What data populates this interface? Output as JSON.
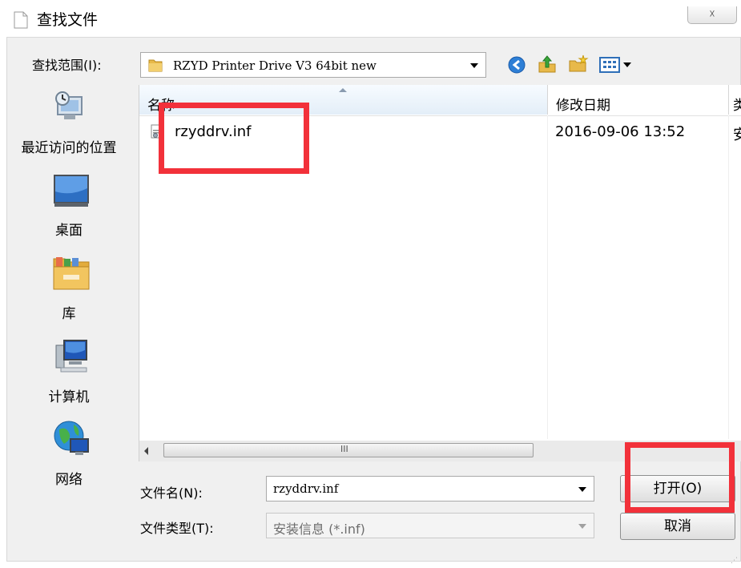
{
  "window": {
    "title": "查找文件",
    "close_label": "☓"
  },
  "toolbar": {
    "lookin_label": "查找范围(I):",
    "lookin_value": "RZYD Printer Drive V3 64bit new",
    "icons": [
      "back-icon",
      "up-folder-icon",
      "new-folder-icon",
      "view-menu-icon"
    ]
  },
  "places": [
    {
      "label": "最近访问的位置",
      "icon": "recent-places-icon"
    },
    {
      "label": "桌面",
      "icon": "desktop-icon"
    },
    {
      "label": "库",
      "icon": "libraries-icon"
    },
    {
      "label": "计算机",
      "icon": "computer-icon"
    },
    {
      "label": "网络",
      "icon": "network-icon"
    }
  ],
  "filelist": {
    "columns": {
      "name": "名称",
      "date": "修改日期",
      "type": "类"
    },
    "files": [
      {
        "name": "rzyddrv.inf",
        "modified": "2016-09-06 13:52",
        "type": "安"
      }
    ],
    "scroll_grip": "III"
  },
  "form": {
    "filename_label": "文件名(N):",
    "filename_value": "rzyddrv.inf",
    "filetype_label": "文件类型(T):",
    "filetype_value": "安装信息 (*.inf)"
  },
  "buttons": {
    "open": "打开(O)",
    "cancel": "取消"
  },
  "colors": {
    "highlight": "#f2313a",
    "dialog_bg": "#f0f0f0"
  }
}
